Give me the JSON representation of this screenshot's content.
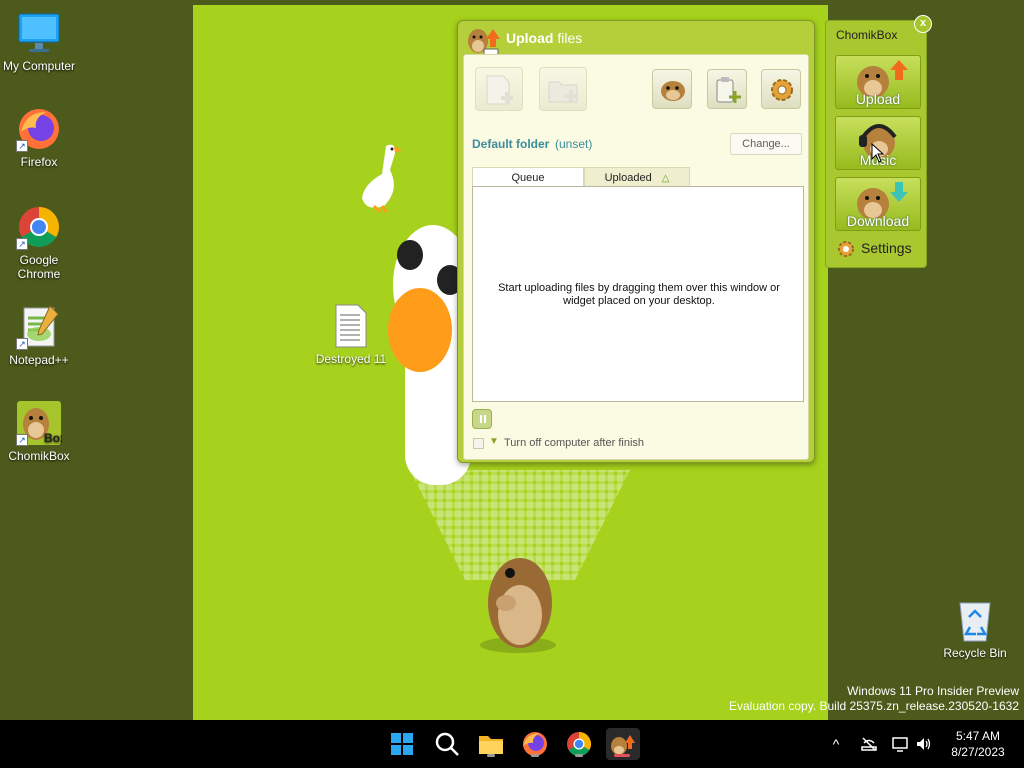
{
  "desktop": {
    "icons": [
      {
        "label": "My Computer",
        "icon": "monitor-icon"
      },
      {
        "label": "Firefox",
        "icon": "firefox-icon"
      },
      {
        "label": "Google Chrome",
        "icon": "chrome-icon"
      },
      {
        "label": "Notepad++",
        "icon": "notepadpp-icon"
      },
      {
        "label": "ChomikBox",
        "icon": "chomikbox-icon"
      },
      {
        "label": "Destroyed 11",
        "icon": "text-file-icon"
      },
      {
        "label": "Recycle Bin",
        "icon": "recycle-bin-icon"
      }
    ]
  },
  "upload_window": {
    "title_bold": "Upload",
    "title_rest": " files",
    "toolbar": [
      {
        "name": "add-files",
        "enabled": false
      },
      {
        "name": "add-folder",
        "enabled": false
      },
      {
        "name": "chomik-account",
        "enabled": true
      },
      {
        "name": "paste-from-clipboard",
        "enabled": true
      },
      {
        "name": "settings",
        "enabled": true
      }
    ],
    "default_folder_label": "Default folder",
    "default_folder_value": "(unset)",
    "change_button": "Change...",
    "tabs": {
      "queue": "Queue",
      "uploaded": "Uploaded",
      "uploaded_marker": "△"
    },
    "queue_empty_message": "Start uploading files by dragging them over this window or widget placed on your desktop.",
    "shutdown_label": "Turn off computer after finish",
    "shutdown_checked": false
  },
  "chomikbox_widget": {
    "title": "ChomikBox",
    "close": "x",
    "buttons": [
      {
        "label": "Upload"
      },
      {
        "label": "Music"
      },
      {
        "label": "Download"
      }
    ],
    "settings_label": "Settings"
  },
  "watermark": {
    "line1": "Windows 11 Pro Insider Preview",
    "line2": "Evaluation copy. Build 25375.zn_release.230520-1632"
  },
  "taskbar": {
    "apps": [
      "start",
      "search",
      "file-explorer",
      "firefox",
      "chrome",
      "chomikbox"
    ],
    "clock_time": "5:47 AM",
    "clock_date": "8/27/2023",
    "tray_chevron": "^"
  },
  "colors": {
    "wallpaper": "#a6d21d",
    "desktop_outer": "#4c5a1b",
    "window_frame": "#b4cf3a",
    "accent_teal": "#3e8c9c",
    "taskbar": "#000000"
  }
}
